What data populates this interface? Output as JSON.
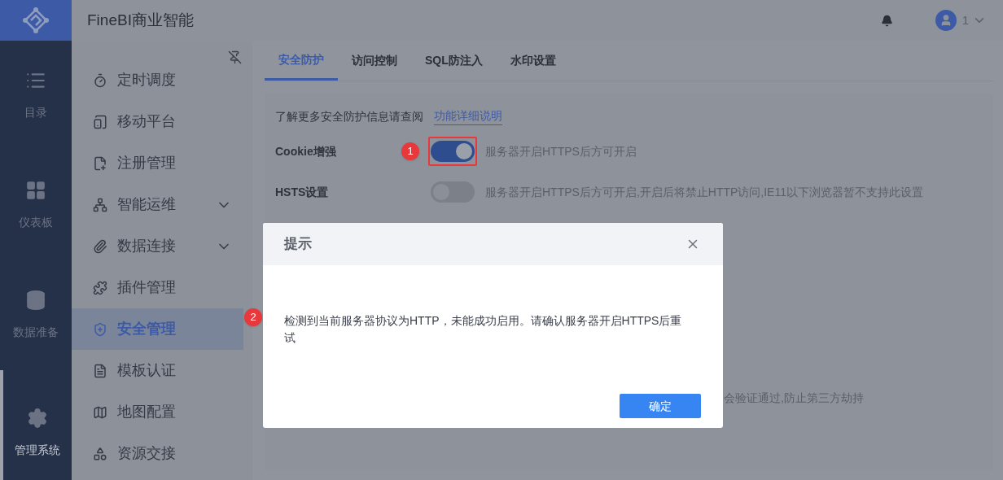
{
  "app_title": "FineBI商业智能",
  "user": {
    "name": "1"
  },
  "nav": [
    {
      "label": "目录",
      "selected": false
    },
    {
      "label": "仪表板",
      "selected": false
    },
    {
      "label": "数据准备",
      "selected": false
    },
    {
      "label": "管理系统",
      "selected": true
    }
  ],
  "sidebar": {
    "items": [
      {
        "label": "定时调度",
        "selected": false,
        "expandable": false
      },
      {
        "label": "移动平台",
        "selected": false,
        "expandable": false
      },
      {
        "label": "注册管理",
        "selected": false,
        "expandable": false
      },
      {
        "label": "智能运维",
        "selected": false,
        "expandable": true
      },
      {
        "label": "数据连接",
        "selected": false,
        "expandable": true
      },
      {
        "label": "插件管理",
        "selected": false,
        "expandable": false
      },
      {
        "label": "安全管理",
        "selected": true,
        "expandable": false
      },
      {
        "label": "模板认证",
        "selected": false,
        "expandable": false
      },
      {
        "label": "地图配置",
        "selected": false,
        "expandable": false
      },
      {
        "label": "资源交接",
        "selected": false,
        "expandable": false
      }
    ]
  },
  "tabs": [
    {
      "label": "安全防护",
      "selected": true
    },
    {
      "label": "访问控制",
      "selected": false
    },
    {
      "label": "SQL防注入",
      "selected": false
    },
    {
      "label": "水印设置",
      "selected": false
    }
  ],
  "intro": {
    "text": "了解更多安全防护信息请查阅",
    "link": "功能详细说明"
  },
  "settings": [
    {
      "label": "Cookie增强",
      "on": true,
      "highlighted": true,
      "badge": "1",
      "description": "服务器开启HTTPS后方可开启"
    },
    {
      "label": "HSTS设置",
      "on": false,
      "highlighted": false,
      "description": "服务器开启HTTPS后方可开启,开启后将禁止HTTP访问,IE11以下浏览器暂不支持此设置"
    }
  ],
  "partial_description": "会验证通过,防止第三方劫持",
  "dialog": {
    "title": "提示",
    "badge": "2",
    "message": "检测到当前服务器协议为HTTP，未能成功启用。请确认服务器开启HTTPS后重试",
    "button": "确定"
  }
}
